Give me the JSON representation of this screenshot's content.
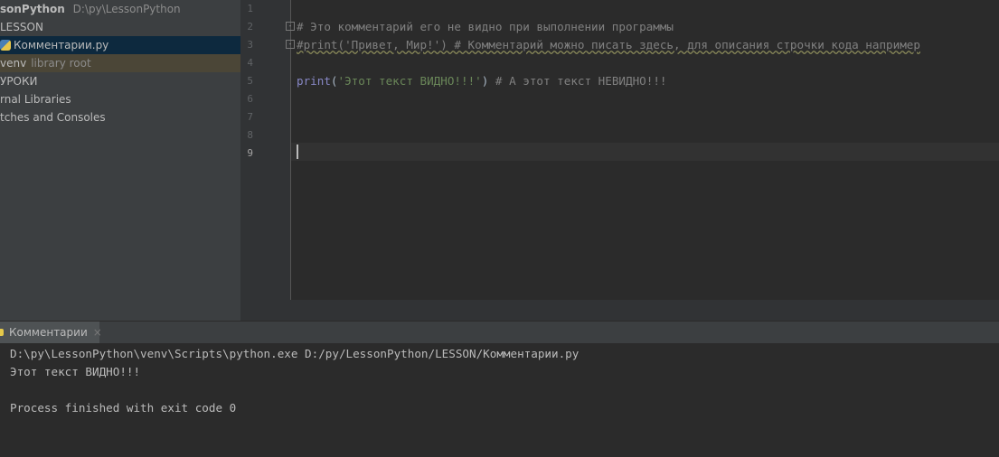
{
  "project_tree": {
    "root_name": "sonPython",
    "root_path": "D:\\py\\LessonPython",
    "items": [
      {
        "label": "LESSON"
      },
      {
        "label": "Комментарии.py"
      },
      {
        "label": "venv",
        "hint": "library root"
      },
      {
        "label": "УРОКИ"
      },
      {
        "label": "rnal Libraries"
      },
      {
        "label": "tches and Consoles"
      }
    ]
  },
  "editor": {
    "line_numbers": [
      "1",
      "2",
      "3",
      "4",
      "5",
      "6",
      "7",
      "8",
      "9"
    ],
    "lines": {
      "l2": "# Это комментарий его не видно при выполнении программы",
      "l3": "#print('Привет, Мир!') # Комментарий можно писать здесь, для описания строчки кода например",
      "l5_kw": "print",
      "l5_open": "(",
      "l5_str": "'Этот текст ВИДНО!!!'",
      "l5_close": ")",
      "l5_comment": " # А этот текст НЕВИДНО!!!"
    },
    "current_line": 9
  },
  "run_panel": {
    "tab_label": "Комментарии",
    "close": "×",
    "output": [
      "D:\\py\\LessonPython\\venv\\Scripts\\python.exe D:/py/LessonPython/LESSON/Комментарии.py",
      "Этот текст ВИДНО!!!",
      "",
      "Process finished with exit code 0"
    ]
  }
}
